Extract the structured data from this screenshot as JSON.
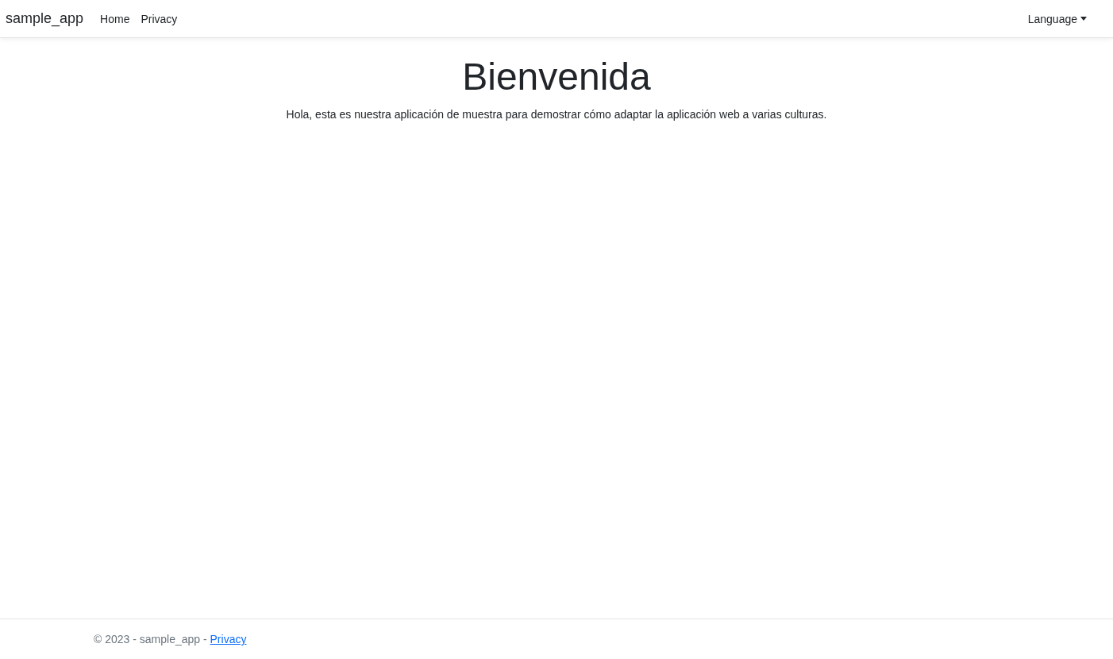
{
  "navbar": {
    "brand": "sample_app",
    "links": [
      "Home",
      "Privacy"
    ],
    "language_menu": {
      "label": "Language",
      "expanded": false
    }
  },
  "main": {
    "heading": "Bienvenida",
    "text": "Hola, esta es nuestra aplicación de muestra para demostrar cómo adaptar la aplicación web a varias culturas."
  },
  "footer": {
    "text": "© 2023 - sample_app - ",
    "link": "Privacy"
  }
}
